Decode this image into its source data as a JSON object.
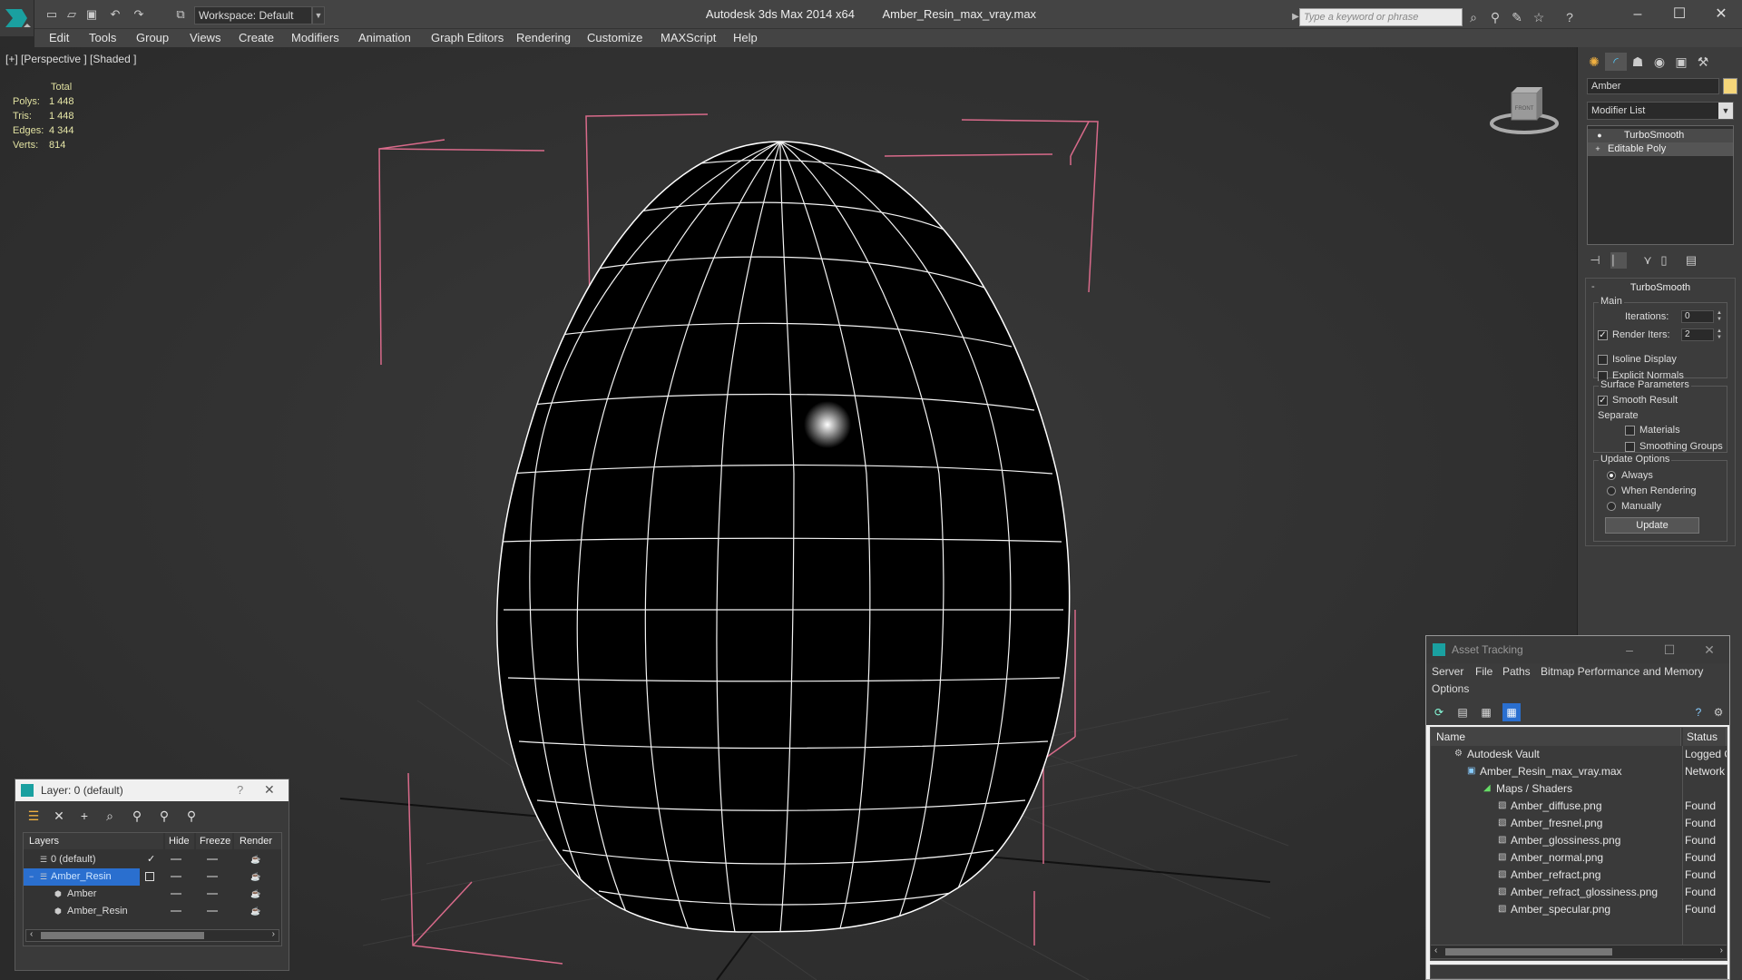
{
  "titlebar": {
    "app_title": "Autodesk 3ds Max  2014 x64",
    "file_title": "Amber_Resin_max_vray.max",
    "workspace": "Workspace: Default",
    "search_placeholder": "Type a keyword or phrase"
  },
  "menubar": {
    "items": [
      "Edit",
      "Tools",
      "Group",
      "Views",
      "Create",
      "Modifiers",
      "Animation",
      "Graph Editors",
      "Rendering",
      "Customize",
      "MAXScript",
      "Help"
    ]
  },
  "viewport": {
    "label": "[+] [Perspective ] [Shaded ]",
    "stats": {
      "header": "Total",
      "rows": [
        {
          "label": "Polys:",
          "value": "1 448"
        },
        {
          "label": "Tris:",
          "value": "1 448"
        },
        {
          "label": "Edges:",
          "value": "4 344"
        },
        {
          "label": "Verts:",
          "value": "814"
        }
      ]
    },
    "viewcube_label": "FRONT"
  },
  "command_panel": {
    "object_name": "Amber",
    "object_color": "#f5d67a",
    "modifier_list": "Modifier List",
    "stack": [
      {
        "label": "TurboSmooth",
        "icon": "bulb-icon"
      },
      {
        "label": "Editable Poly",
        "icon": "plus-icon"
      }
    ],
    "turbosmooth": {
      "title": "TurboSmooth",
      "main_label": "Main",
      "iterations_label": "Iterations:",
      "iterations_value": "0",
      "render_iters_label": "Render Iters:",
      "render_iters_value": "2",
      "isoline_label": "Isoline Display",
      "explicit_normals_label": "Explicit Normals",
      "surface_label": "Surface Parameters",
      "smooth_result_label": "Smooth Result",
      "separate_label": "Separate",
      "materials_label": "Materials",
      "smoothing_groups_label": "Smoothing Groups",
      "update_options_label": "Update Options",
      "always_label": "Always",
      "when_rendering_label": "When Rendering",
      "manually_label": "Manually",
      "update_button": "Update"
    }
  },
  "layer_window": {
    "title": "Layer: 0 (default)",
    "help": "?",
    "columns": [
      "Layers",
      "Hide",
      "Freeze",
      "Render"
    ],
    "rows": [
      {
        "name": "0 (default)",
        "selected": false,
        "indent": 1
      },
      {
        "name": "Amber_Resin",
        "selected": true,
        "indent": 1
      },
      {
        "name": "Amber",
        "selected": false,
        "indent": 2
      },
      {
        "name": "Amber_Resin",
        "selected": false,
        "indent": 2
      }
    ]
  },
  "asset_tracking": {
    "title": "Asset Tracking",
    "menu": [
      "Server",
      "File",
      "Paths",
      "Bitmap Performance and Memory",
      "Options"
    ],
    "columns": [
      "Name",
      "Status"
    ],
    "rows": [
      {
        "name": "Autodesk Vault",
        "status": "Logged O",
        "indent": 0
      },
      {
        "name": "Amber_Resin_max_vray.max",
        "status": "Network",
        "indent": 1
      },
      {
        "name": "Maps / Shaders",
        "status": "",
        "indent": 2
      },
      {
        "name": "Amber_diffuse.png",
        "status": "Found",
        "indent": 3
      },
      {
        "name": "Amber_fresnel.png",
        "status": "Found",
        "indent": 3
      },
      {
        "name": "Amber_glossiness.png",
        "status": "Found",
        "indent": 3
      },
      {
        "name": "Amber_normal.png",
        "status": "Found",
        "indent": 3
      },
      {
        "name": "Amber_refract.png",
        "status": "Found",
        "indent": 3
      },
      {
        "name": "Amber_refract_glossiness.png",
        "status": "Found",
        "indent": 3
      },
      {
        "name": "Amber_specular.png",
        "status": "Found",
        "indent": 3
      }
    ]
  }
}
